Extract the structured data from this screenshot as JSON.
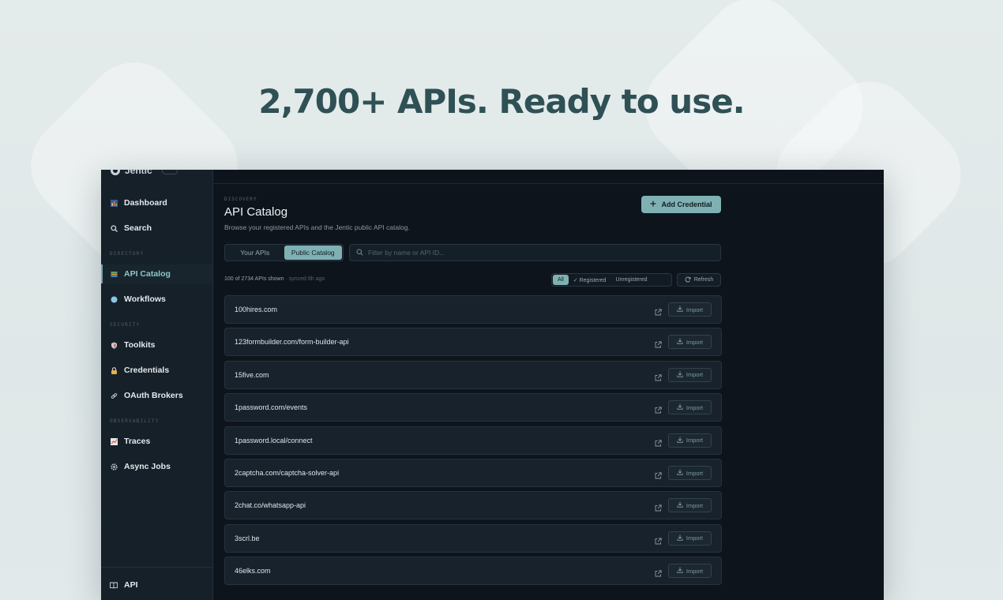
{
  "headline": "2,700+ APIs. Ready to use.",
  "brand": {
    "name": "Jentic",
    "badge": ""
  },
  "user": {
    "info": ""
  },
  "sidebar": {
    "items": [
      {
        "label": "Dashboard",
        "icon": "dashboard-icon"
      },
      {
        "label": "Search",
        "icon": "search-icon"
      }
    ],
    "section_directory": "DIRECTORY",
    "directory_items": [
      {
        "label": "API Catalog",
        "icon": "books-icon"
      },
      {
        "label": "Workflows",
        "icon": "globe-icon"
      }
    ],
    "section_security": "SECURITY",
    "security_items": [
      {
        "label": "Toolkits",
        "icon": "shield-icon"
      },
      {
        "label": "Credentials",
        "icon": "lock-icon"
      },
      {
        "label": "OAuth Brokers",
        "icon": "link-icon"
      }
    ],
    "section_observability": "OBSERVABILITY",
    "observability_items": [
      {
        "label": "Traces",
        "icon": "chart-icon"
      },
      {
        "label": "Async Jobs",
        "icon": "gear-icon"
      }
    ],
    "bottom_item": {
      "label": "API",
      "icon": "book-icon"
    }
  },
  "main": {
    "eyebrow": "DISCOVERY",
    "title": "API Catalog",
    "subtitle": "Browse your registered APIs and the Jentic public API catalog.",
    "add_button": "Add Credential",
    "tabs": [
      "Your APIs",
      "Public Catalog"
    ],
    "active_tab": "Public Catalog",
    "filter_placeholder": "Filter by name or API ID...",
    "count_text": "100 of 2734 APIs shown",
    "synced_text": "· synced 6h ago",
    "segments": [
      "All",
      "✓ Registered",
      "Unregistered"
    ],
    "active_segment": "All",
    "refresh_label": "Refresh",
    "import_label": "Import",
    "apis": [
      "100hires.com",
      "123formbuilder.com/form-builder-api",
      "15five.com",
      "1password.com/events",
      "1password.local/connect",
      "2captcha.com/captcha-solver-api",
      "2chat.co/whatsapp-api",
      "3scrl.be",
      "46elks.com"
    ]
  },
  "colors": {
    "accent": "#7fb1b3",
    "headline": "#2f5055",
    "app_bg": "#0d141c",
    "sidebar_bg": "#162029"
  }
}
